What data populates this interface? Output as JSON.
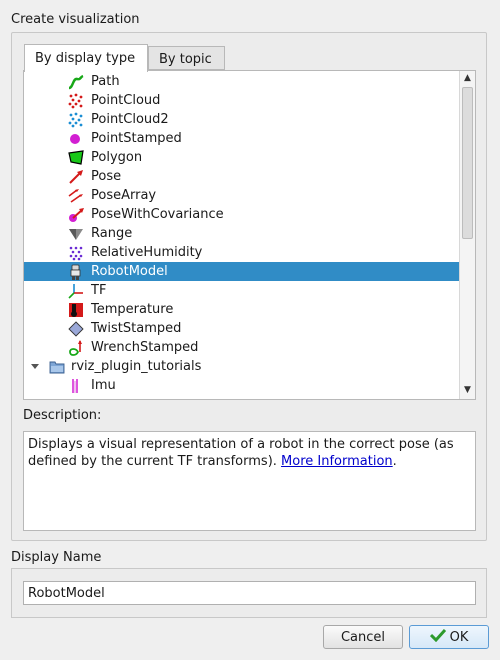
{
  "dialog": {
    "title": "Create visualization"
  },
  "tabs": [
    {
      "label": "By display type",
      "active": true
    },
    {
      "label": "By topic",
      "active": false
    }
  ],
  "tree": {
    "items": [
      {
        "label": "Path",
        "icon": "path-icon"
      },
      {
        "label": "PointCloud",
        "icon": "pointcloud-icon"
      },
      {
        "label": "PointCloud2",
        "icon": "pointcloud2-icon"
      },
      {
        "label": "PointStamped",
        "icon": "pointstamped-icon"
      },
      {
        "label": "Polygon",
        "icon": "polygon-icon"
      },
      {
        "label": "Pose",
        "icon": "pose-icon"
      },
      {
        "label": "PoseArray",
        "icon": "posearray-icon"
      },
      {
        "label": "PoseWithCovariance",
        "icon": "posewithcovariance-icon"
      },
      {
        "label": "Range",
        "icon": "range-icon"
      },
      {
        "label": "RelativeHumidity",
        "icon": "relativehumidity-icon"
      },
      {
        "label": "RobotModel",
        "icon": "robotmodel-icon",
        "selected": true
      },
      {
        "label": "TF",
        "icon": "tf-icon"
      },
      {
        "label": "Temperature",
        "icon": "temperature-icon"
      },
      {
        "label": "TwistStamped",
        "icon": "twiststamped-icon"
      },
      {
        "label": "WrenchStamped",
        "icon": "wrenchstamped-icon"
      },
      {
        "label": "rviz_plugin_tutorials",
        "icon": "folder-icon",
        "expanded": true
      },
      {
        "label": "Imu",
        "icon": "imu-icon"
      }
    ]
  },
  "description": {
    "label": "Description:",
    "text": "Displays a visual representation of a robot in the correct pose (as defined by the current TF transforms).",
    "link_text": "More Information",
    "suffix": "."
  },
  "display_name": {
    "label": "Display Name",
    "value": "RobotModel"
  },
  "buttons": {
    "cancel": "Cancel",
    "ok": "OK"
  },
  "colors": {
    "selection": "#308cc6",
    "link": "#0000cc"
  }
}
